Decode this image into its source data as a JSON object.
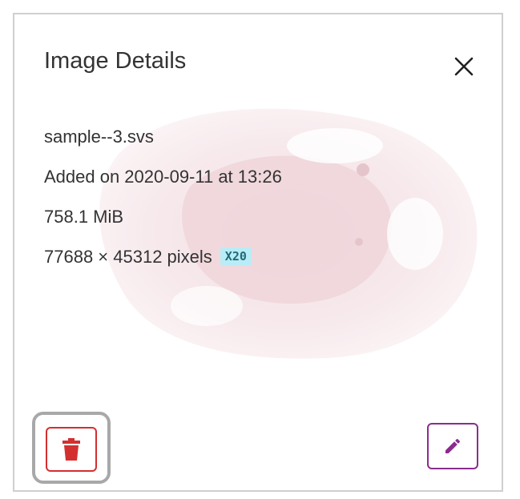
{
  "panel": {
    "title": "Image Details",
    "close_icon": "close-icon"
  },
  "image": {
    "name": "sample--3.svs",
    "added": "Added on 2020-09-11 at 13:26",
    "size": "758.1 MiB",
    "dimensions": "77688 × 45312 pixels",
    "magnification": "X20"
  },
  "actions": {
    "delete_icon": "trash-icon",
    "edit_icon": "pencil-icon"
  },
  "colors": {
    "delete": "#d32f2f",
    "edit": "#8a2c8f",
    "badge_bg": "#b9ecf6",
    "badge_text": "#1f6b78"
  }
}
